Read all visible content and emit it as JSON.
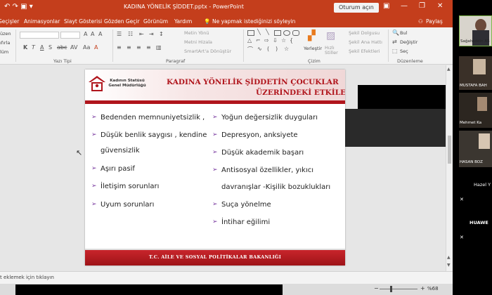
{
  "window": {
    "title": "KADINA YÖNELİK ŞİDDET.pptx  -  PowerPoint",
    "signin": "Oturum açın",
    "minimize_icon": "—",
    "restore_icon": "❐",
    "close_icon": "✕",
    "qat": "↶  ↷  ▣  ▾"
  },
  "tabs": [
    "Geçişler",
    "Animasyonlar",
    "Slayt Gösterisi",
    "Gözden Geçir",
    "Görünüm",
    "Yardım",
    "Ne yapmak istediğinizi söyleyin",
    "Paylaş"
  ],
  "ribbon": {
    "groups": {
      "font": "Yazı Tipi",
      "paragraph": "Paragraf",
      "drawing": "Çizim",
      "editing": "Düzenleme"
    },
    "left_labels": [
      "üzen",
      "ıfırla",
      "lüm"
    ],
    "text_direction": "Metin Yönü",
    "align_text": "Metni Hizala",
    "smartart": "SmartArt'a Dönüştür",
    "arrange": "Yerleştir",
    "quick_styles": "Hızlı Stiller",
    "shape_fill": "Şekil Dolgusu",
    "shape_outline": "Şekil Ana Hattı",
    "shape_effects": "Şekil Efektleri",
    "find": "Bul",
    "replace": "Değiştir",
    "select": "Seç"
  },
  "slide": {
    "logo_text_1": "Kadının Statüsü",
    "logo_text_2": "Genel Müdürlüğü",
    "title_line1": "KADINA YÖNELİK ŞİDDETİN ÇOCUKLAR",
    "title_line2": "ÜZERİNDEKİ ETKİLERİ",
    "left_items": [
      "Bedenden memnuniyetsizlik ,",
      "Düşük benlik saygısı , kendine",
      "güvensizlik",
      "Aşırı pasif",
      "İletişim sorunları",
      "Uyum sorunları"
    ],
    "right_items": [
      "Yoğun değersizlik duyguları",
      "Depresyon, anksiyete",
      "Düşük akademik başarı",
      "Antisosyal özellikler, yıkıcı",
      "davranışlar -Kişilik bozuklukları",
      "Suça yönelme",
      "İntihar eğilimi"
    ],
    "footer": "T.C. AİLE VE SOSYAL POLİTİKALAR BAKANLIĞI",
    "bullet_glyph": "➢"
  },
  "status": {
    "notes": "t eklemek için tıklayın",
    "zoom": "%68",
    "zoom_minus": "−",
    "zoom_plus": "+"
  },
  "participants": {
    "tile1": "Sağahaddin AS",
    "tile2": "MUSTAFA BAH",
    "tile3": "Mehmet Ka",
    "tile4": "HASAN BOZ",
    "tile5": "Hazel Y",
    "tile6": "HUAWE"
  },
  "colors": {
    "ppt_accent": "#c43e1c",
    "slide_red": "#b0151c",
    "bullet": "#7a3aa0"
  }
}
